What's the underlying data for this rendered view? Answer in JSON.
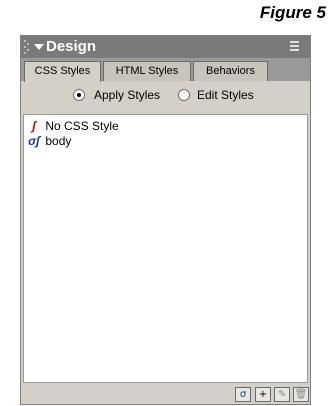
{
  "figure_label": "Figure 5",
  "panel": {
    "title": "Design",
    "tabs": [
      {
        "label": "CSS Styles",
        "active": true
      },
      {
        "label": "HTML Styles",
        "active": false
      },
      {
        "label": "Behaviors",
        "active": false
      }
    ],
    "radio_options": [
      {
        "label": "Apply Styles",
        "selected": true
      },
      {
        "label": "Edit Styles",
        "selected": false
      }
    ],
    "styles_list": [
      {
        "label": "No CSS Style",
        "icon": "no-style-icon"
      },
      {
        "label": "body",
        "icon": "style-icon"
      }
    ],
    "bottom_icons": [
      "attach-stylesheet-icon",
      "new-style-icon",
      "edit-style-icon",
      "delete-icon"
    ]
  },
  "colors": {
    "panel_bg": "#d4d0c8",
    "titlebar_bg": "#7a7a7a",
    "tabs_bg": "#9a9a9a"
  }
}
